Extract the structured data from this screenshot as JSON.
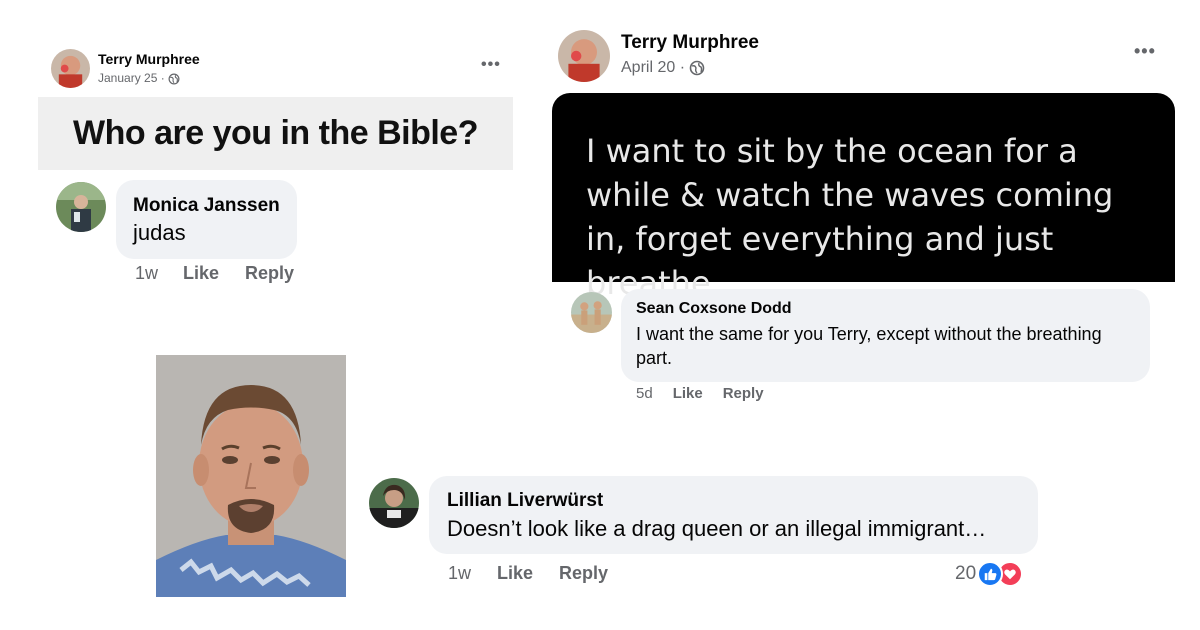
{
  "post_left": {
    "author": "Terry Murphree",
    "date": "January 25 ·",
    "image_text": "Who are you in the Bible?",
    "comment": {
      "author": "Monica Janssen",
      "text": "judas",
      "time": "1w",
      "like_label": "Like",
      "reply_label": "Reply"
    }
  },
  "post_right": {
    "author": "Terry Murphree",
    "date": "April 20 ·",
    "image_text": "I want to sit by the ocean for a while & watch the waves coming in, forget everything and just breathe.",
    "comment": {
      "author": "Sean Coxsone Dodd",
      "text": "I want the same for you Terry, except without the breathing part.",
      "time": "5d",
      "like_label": "Like",
      "reply_label": "Reply"
    }
  },
  "bottom_comment": {
    "author": "Lillian Liverwürst",
    "text": "Doesn’t look like a drag queen or an illegal immigrant…",
    "time": "1w",
    "like_label": "Like",
    "reply_label": "Reply",
    "reaction_count": "20",
    "reaction_icons": [
      "like-icon",
      "love-icon"
    ]
  },
  "colors": {
    "bubble": "#f0f2f5",
    "meta": "#65676b",
    "like_blue": "#1877f2",
    "love_red": "#f33e58"
  }
}
